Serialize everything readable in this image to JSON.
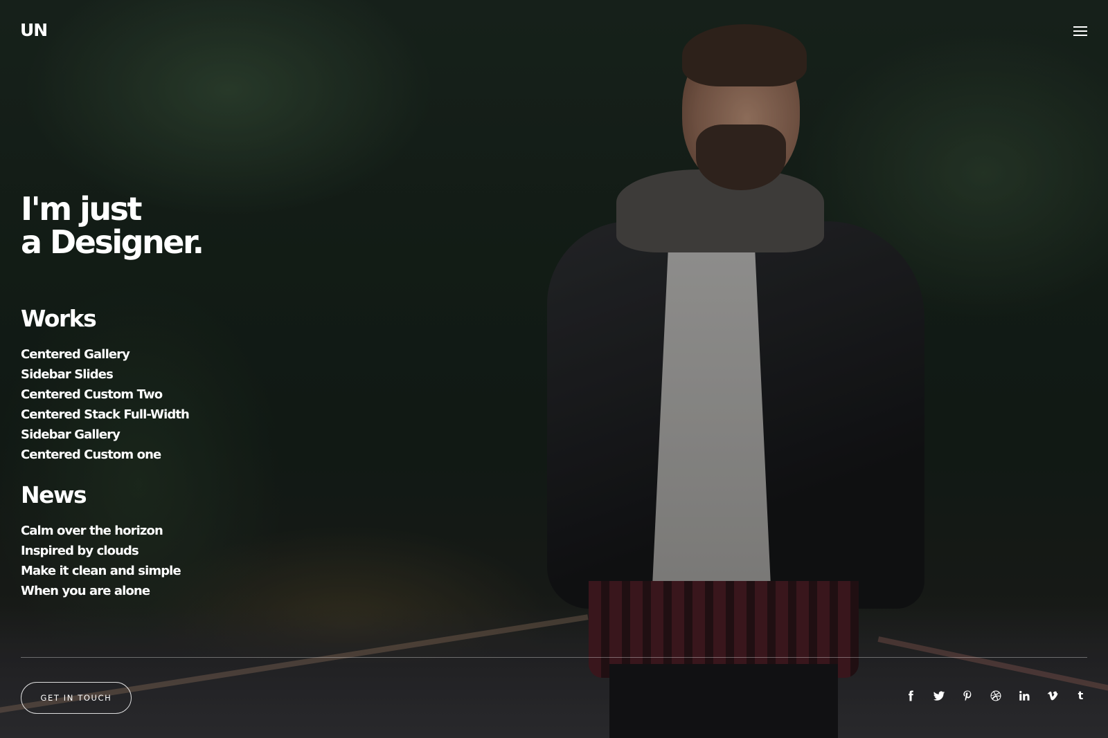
{
  "header": {
    "logo": "UN",
    "menu_icon": "hamburger-icon"
  },
  "hero": {
    "line1": "I'm just",
    "line2": "a Designer."
  },
  "works": {
    "title": "Works",
    "items": [
      "Centered Gallery",
      "Sidebar Slides",
      "Centered Custom Two",
      "Centered Stack Full-Width",
      "Sidebar Gallery",
      "Centered Custom one"
    ]
  },
  "news": {
    "title": "News",
    "items": [
      "Calm over the horizon",
      "Inspired by clouds",
      "Make it clean and simple",
      "When you are alone"
    ]
  },
  "footer": {
    "cta_label": "GET IN TOUCH",
    "social_icons": [
      "facebook-icon",
      "twitter-icon",
      "pinterest-icon",
      "dribbble-icon",
      "linkedin-icon",
      "vimeo-icon",
      "tumblr-icon"
    ]
  },
  "colors": {
    "text": "#ffffff",
    "background": "#1a261e"
  }
}
